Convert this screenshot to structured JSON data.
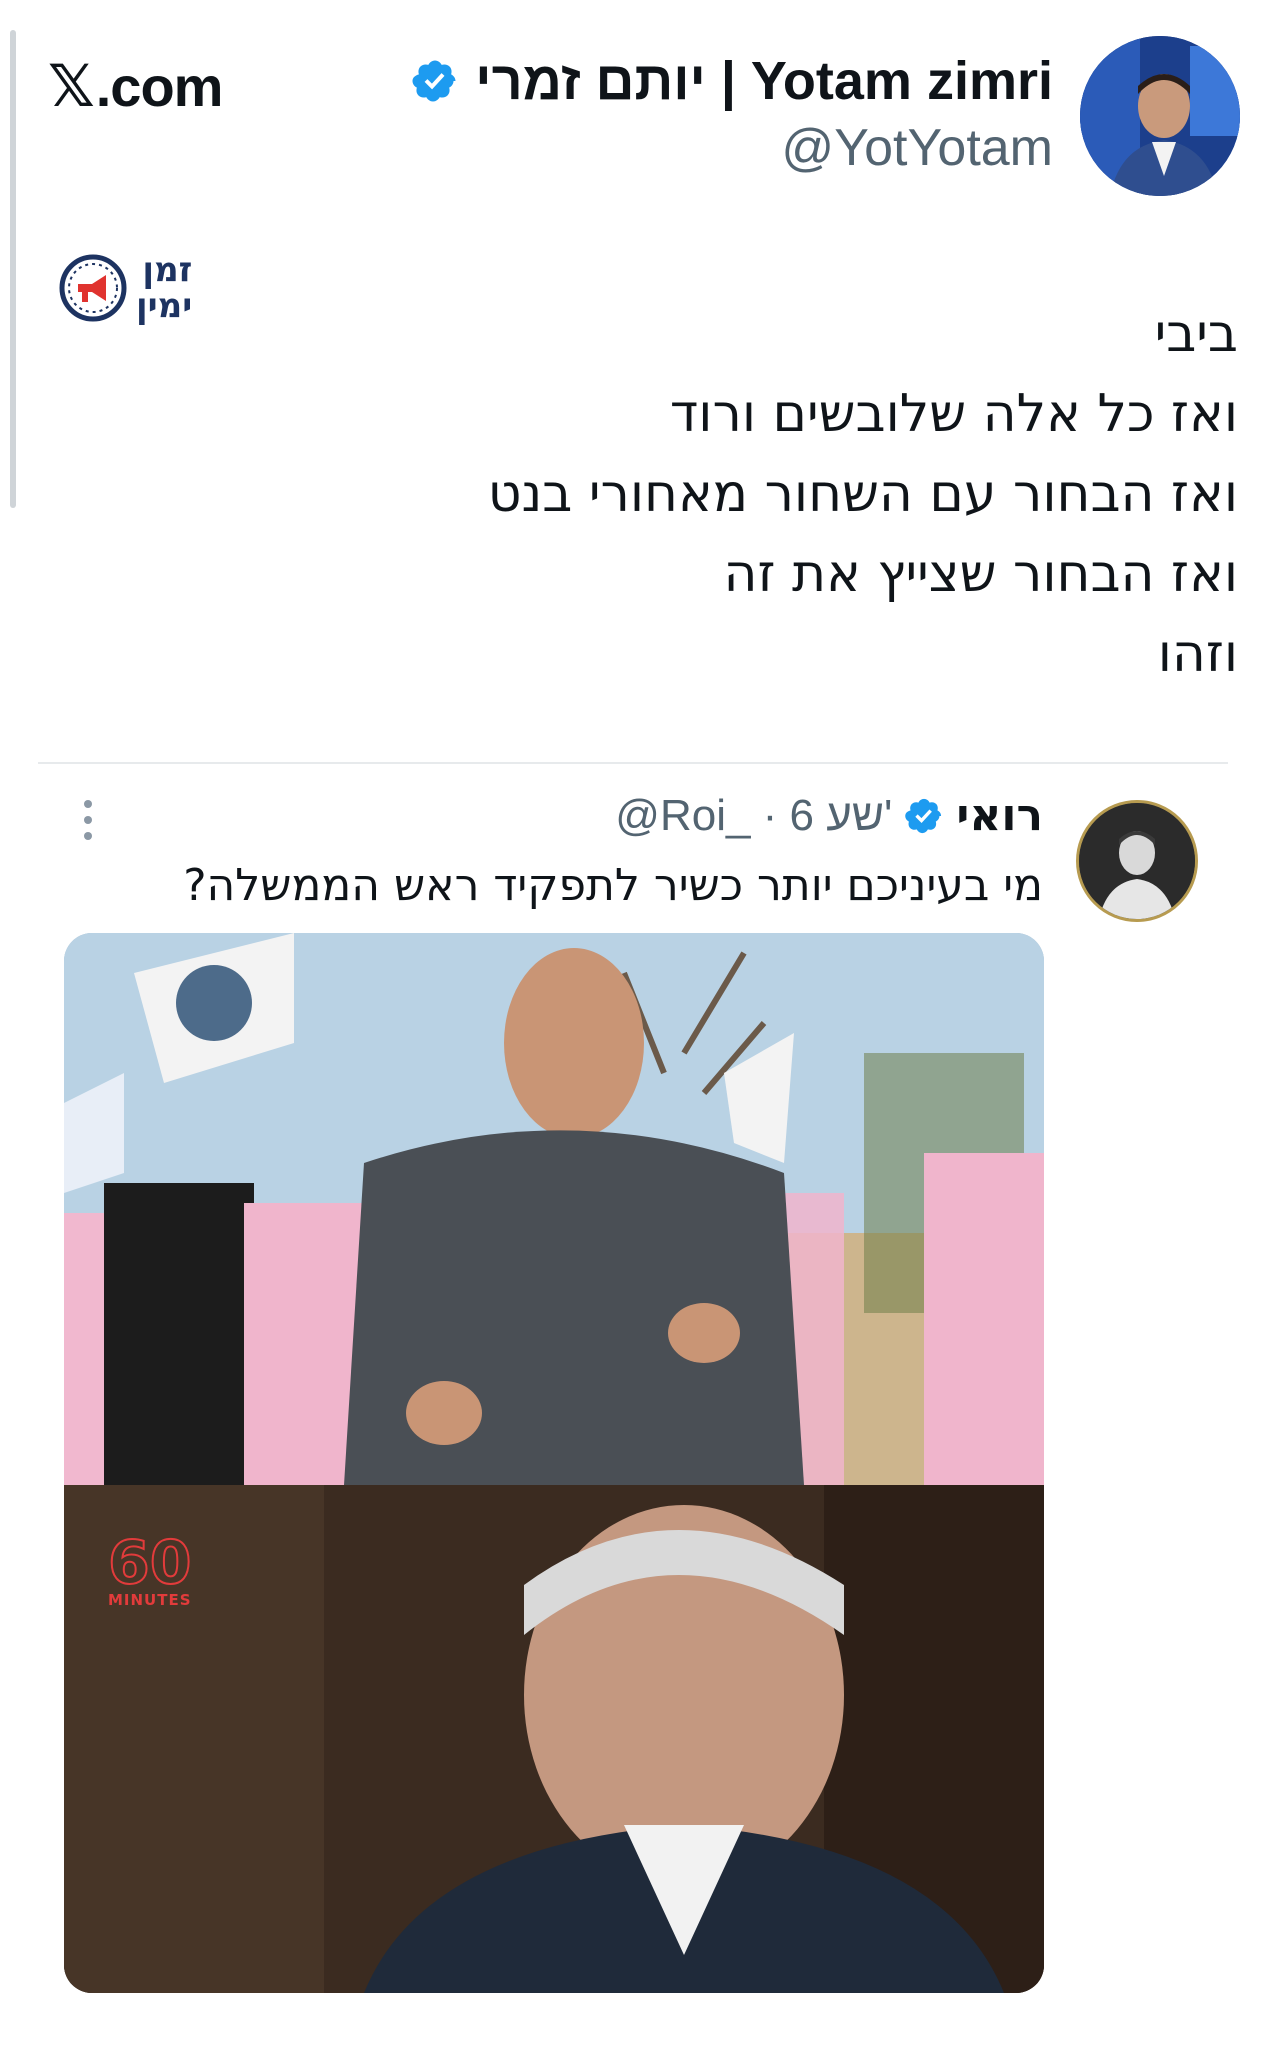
{
  "site": {
    "x_glyph": "𝕏",
    "domain": ".com"
  },
  "author": {
    "name": "יותם זמרי | Yotam zimri",
    "handle": "@YotYotam",
    "verified_color": "#1d9bf0"
  },
  "brand": {
    "line1": "זמן",
    "line2": "ימין",
    "color": "#1d3361",
    "accent": "#e0332f"
  },
  "tweet": {
    "lines": [
      "ביבי",
      "ואז כל אלה שלובשים ורוד",
      "ואז הבחור עם השחור מאחורי בנט",
      "ואז הבחור שצייץ את זה",
      "וזהו"
    ]
  },
  "quoted": {
    "name": "רואי",
    "meta": "@Roi_ · 6 שע'",
    "text": "מי בעיניכם יותר כשיר לתפקיד ראש הממשלה?",
    "image": {
      "network_logo_number": "60",
      "network_logo_word": "MINUTES"
    }
  },
  "icons": {
    "verified": "verified-badge-icon",
    "more": "more-options-icon",
    "brand_clock": "megaphone-clock-icon"
  }
}
